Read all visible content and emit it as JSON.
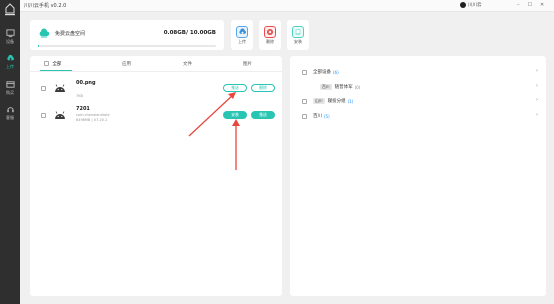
{
  "app": {
    "title": "川川云手机 v0.2.0",
    "user": "川川云"
  },
  "sidebar": {
    "items": [
      {
        "label": "设备",
        "icon": "monitor-icon"
      },
      {
        "label": "上传",
        "icon": "cloud-upload-icon",
        "active": true
      },
      {
        "label": "购买",
        "icon": "card-icon"
      },
      {
        "label": "客服",
        "icon": "headset-icon"
      }
    ]
  },
  "storage": {
    "label": "免费云盘空间",
    "usage": "0.08GB/ 10.00GB",
    "used_fraction": 0.008
  },
  "actions": {
    "upload": "上传",
    "delete": "删除",
    "install": "安装"
  },
  "tabs": [
    "全部",
    "应用",
    "文件",
    "图片"
  ],
  "files": [
    {
      "name": "00.png",
      "meta": "7KB",
      "btn1": "推送",
      "btn2": "删除",
      "btn1_style": "outline",
      "btn2_style": "outline"
    },
    {
      "name": "7201",
      "meta1": "com.chenaiandroid",
      "meta2": "8498MB  |  V7.20.1",
      "btn1": "安装",
      "btn2": "推送",
      "btn1_style": "solid",
      "btn2_style": "solid"
    }
  ],
  "devices": {
    "all": {
      "label": "全部设备",
      "count": "(6)"
    },
    "groups": [
      {
        "tag": "百川",
        "name": "随普体军",
        "count": "(0)",
        "count_color": "grey",
        "checkbox": false
      },
      {
        "tag": "山川",
        "name": "寝投分组",
        "count": "(1)",
        "count_color": "blue",
        "checkbox": true
      },
      {
        "tag": "",
        "name": "百川",
        "count": "(5)",
        "count_color": "blue",
        "checkbox": true
      }
    ]
  },
  "colors": {
    "accent": "#28c5b3",
    "sidebar": "#2f2f2f",
    "arrow": "#e8473f"
  }
}
